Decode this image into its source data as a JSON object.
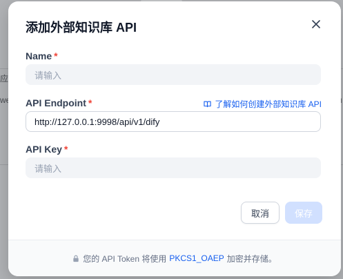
{
  "background": {
    "fragments": [
      "应",
      "we",
      "u"
    ]
  },
  "modal": {
    "title": "添加外部知识库 API",
    "close_icon": "close-icon",
    "name": {
      "label": "Name",
      "required": "*",
      "placeholder": "请输入",
      "value": ""
    },
    "endpoint": {
      "label": "API Endpoint",
      "required": "*",
      "value": "http://127.0.0.1:9998/api/v1/dify",
      "help_icon": "book-icon",
      "help_link": "了解如何创建外部知识库 API"
    },
    "api_key": {
      "label": "API Key",
      "required": "*",
      "placeholder": "请输入",
      "value": ""
    },
    "buttons": {
      "cancel": "取消",
      "save": "保存"
    },
    "footer": {
      "lock_icon": "lock-icon",
      "prefix": "您的 API Token 将使用",
      "protocol": "PKCS1_OAEP",
      "suffix": "加密并存储。"
    }
  },
  "colors": {
    "accent": "#155eef",
    "required": "#f04438",
    "save_disabled": "#d1e0ff"
  }
}
